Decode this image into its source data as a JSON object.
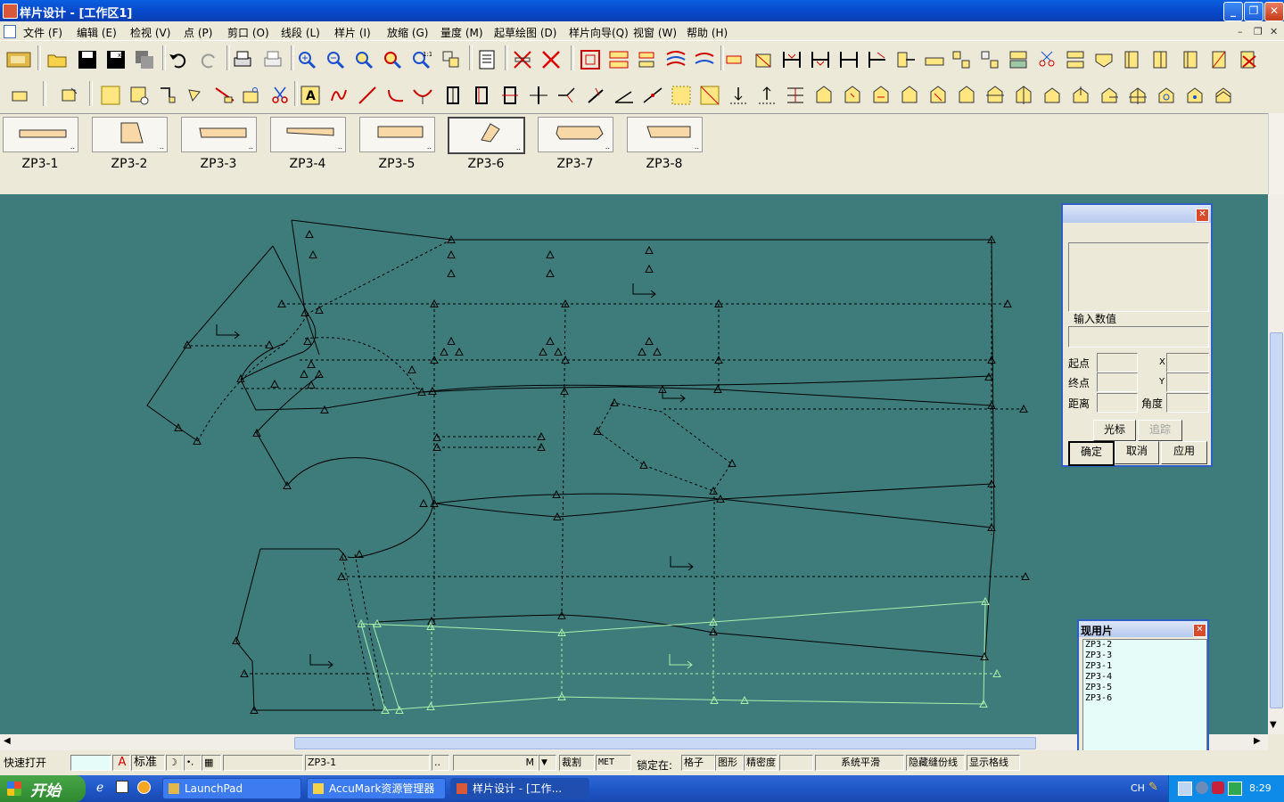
{
  "window": {
    "title": "样片设计 - [工作区1]"
  },
  "menu": [
    "文件 (F)",
    "编辑 (E)",
    "检视 (V)",
    "点 (P)",
    "剪口 (O)",
    "线段 (L)",
    "样片 (I)",
    "放缩 (G)",
    "量度 (M)",
    "起草绘图 (D)",
    "样片向导(Q)",
    "视窗 (W)",
    "帮助 (H)"
  ],
  "pieces": [
    "ZP3-1",
    "ZP3-2",
    "ZP3-3",
    "ZP3-4",
    "ZP3-5",
    "ZP3-6",
    "ZP3-7",
    "ZP3-8"
  ],
  "selected_piece": "ZP3-6",
  "dialog": {
    "input_label": "输入数值",
    "start_label": "起点",
    "end_label": "终点",
    "dist_label": "距离",
    "x_label": "X",
    "y_label": "Y",
    "angle_label": "角度",
    "cursor_btn": "光标",
    "trace_btn": "追踪",
    "ok_btn": "确定",
    "cancel_btn": "取消",
    "apply_btn": "应用"
  },
  "current_pieces": {
    "title": "现用片",
    "items": [
      "ZP3-2",
      "ZP3-3",
      "ZP3-1",
      "ZP3-4",
      "ZP3-5",
      "ZP3-6"
    ]
  },
  "status": {
    "quick_open": "快速打开",
    "standard": "标准",
    "piece_field": "ZP3-1",
    "ellipsis": "..",
    "m": "M",
    "cut": "裁割",
    "met": "MET",
    "lock_label": "锁定在:",
    "grid": "格子",
    "shape": "图形",
    "density": "精密度",
    "smooth": "系统平滑",
    "hide_seam": "隐藏缝份线",
    "show_grid": "显示格线"
  },
  "taskbar": {
    "start": "开始",
    "tasks": [
      "LaunchPad",
      "AccuMark资源管理器",
      "样片设计 - [工作..."
    ],
    "lang": "CH",
    "clock": "8:29"
  }
}
